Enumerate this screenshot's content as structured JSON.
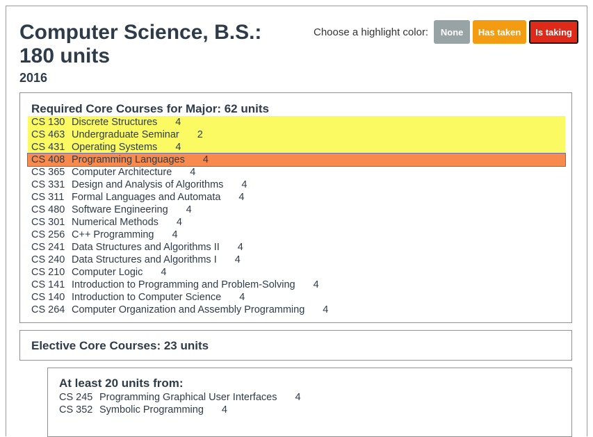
{
  "header": {
    "title": "Computer Science, B.S.: 180 units",
    "year": "2016"
  },
  "highlight": {
    "label": "Choose a highlight color:",
    "buttons": [
      {
        "label": "None",
        "color": "#97a3a4"
      },
      {
        "label": "Has taken",
        "color": "#f39c12"
      },
      {
        "label": "Is taking",
        "color": "#de2a18"
      }
    ]
  },
  "core": {
    "title": "Required Core Courses for Major: 62 units",
    "courses": [
      {
        "code": "CS 130",
        "name": "Discrete Structures",
        "units": "4",
        "highlight": "has-taken-yellow"
      },
      {
        "code": "CS 463",
        "name": "Undergraduate Seminar",
        "units": "2",
        "highlight": "has-taken-yellow"
      },
      {
        "code": "CS 431",
        "name": "Operating Systems",
        "units": "4",
        "highlight": "has-taken-yellow"
      },
      {
        "code": "CS 408",
        "name": "Programming Languages",
        "units": "4",
        "highlight": "is-taking-orange"
      },
      {
        "code": "CS 365",
        "name": "Computer Architecture",
        "units": "4"
      },
      {
        "code": "CS 331",
        "name": "Design and Analysis of Algorithms",
        "units": "4"
      },
      {
        "code": "CS 311",
        "name": "Formal Languages and Automata",
        "units": "4"
      },
      {
        "code": "CS 480",
        "name": "Software Engineering",
        "units": "4"
      },
      {
        "code": "CS 301",
        "name": "Numerical Methods",
        "units": "4"
      },
      {
        "code": "CS 256",
        "name": "C++ Programming",
        "units": "4"
      },
      {
        "code": "CS 241",
        "name": "Data Structures and Algorithms II",
        "units": "4"
      },
      {
        "code": "CS 240",
        "name": "Data Structures and Algorithms I",
        "units": "4"
      },
      {
        "code": "CS 210",
        "name": "Computer Logic",
        "units": "4"
      },
      {
        "code": "CS 141",
        "name": "Introduction to Programming and Problem-Solving",
        "units": "4"
      },
      {
        "code": "CS 140",
        "name": "Introduction to Computer Science",
        "units": "4"
      },
      {
        "code": "CS 264",
        "name": "Computer Organization and Assembly Programming",
        "units": "4"
      }
    ]
  },
  "elective": {
    "title": "Elective Core Courses: 23 units"
  },
  "atleast": {
    "title": "At least 20 units from:",
    "courses": [
      {
        "code": "CS 245",
        "name": "Programming Graphical User Interfaces",
        "units": "4"
      },
      {
        "code": "CS 352",
        "name": "Symbolic Programming",
        "units": "4"
      }
    ]
  }
}
